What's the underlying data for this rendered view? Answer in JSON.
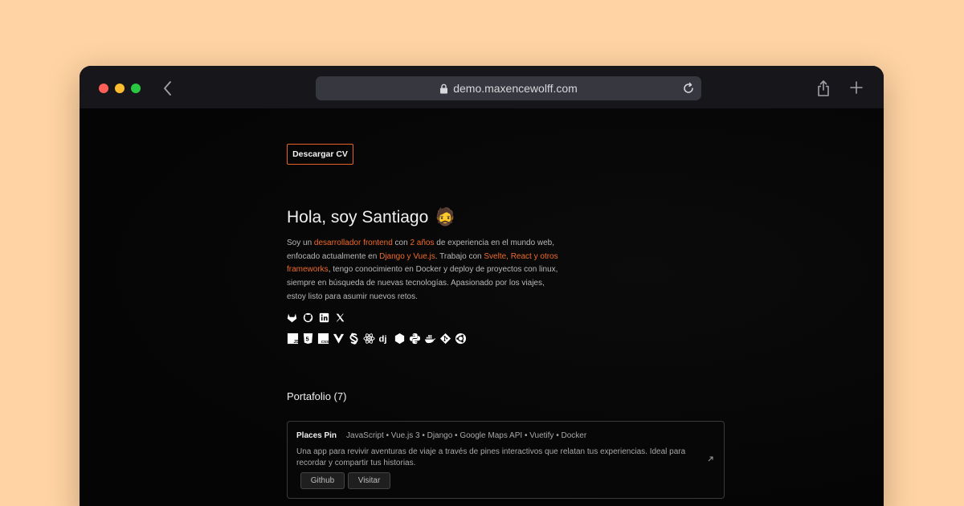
{
  "browser": {
    "url": "demo.maxencewolff.com"
  },
  "page": {
    "cv_button": "Descargar CV",
    "greeting": "Hola, soy Santiago",
    "greeting_emoji": "🧔",
    "bio": {
      "p1": "Soy un ",
      "h1": "desarrollador frontend",
      "p2": " con ",
      "h2": "2 años",
      "p3": " de experiencia en el mundo web, enfocado actualmente en ",
      "h3": "Django y Vue.js",
      "p4": ". Trabajo con ",
      "h4": "Svelte, React y otros frameworks",
      "p5": ", tengo conocimiento en Docker y deploy de proyectos con linux, siempre en búsqueda de nuevas tecnologías. Apasionado por los viajes, estoy listo para asumir nuevos retos."
    },
    "social_icons": [
      "gitlab-icon",
      "github-icon",
      "linkedin-icon",
      "x-icon"
    ],
    "tech_icons": [
      "javascript-icon",
      "html5-icon",
      "css3-icon",
      "vue-icon",
      "svelte-icon",
      "react-icon",
      "django-icon",
      "nodejs-icon",
      "python-icon",
      "docker-icon",
      "git-icon",
      "ubuntu-icon"
    ],
    "portfolio_title": "Portafolio (7)",
    "projects": [
      {
        "name": "Places Pin",
        "stack": "JavaScript • Vue.js 3 • Django • Google Maps API • Vuetify • Docker",
        "description": "Una app para revivir aventuras de viaje a través de pines interactivos que relatan tus experiencias. Ideal para recordar y compartir tus historias.",
        "github_label": "Github",
        "visit_label": "Visitar"
      }
    ]
  },
  "colors": {
    "accent": "#f06a2b",
    "background": "#ffd3a3"
  }
}
